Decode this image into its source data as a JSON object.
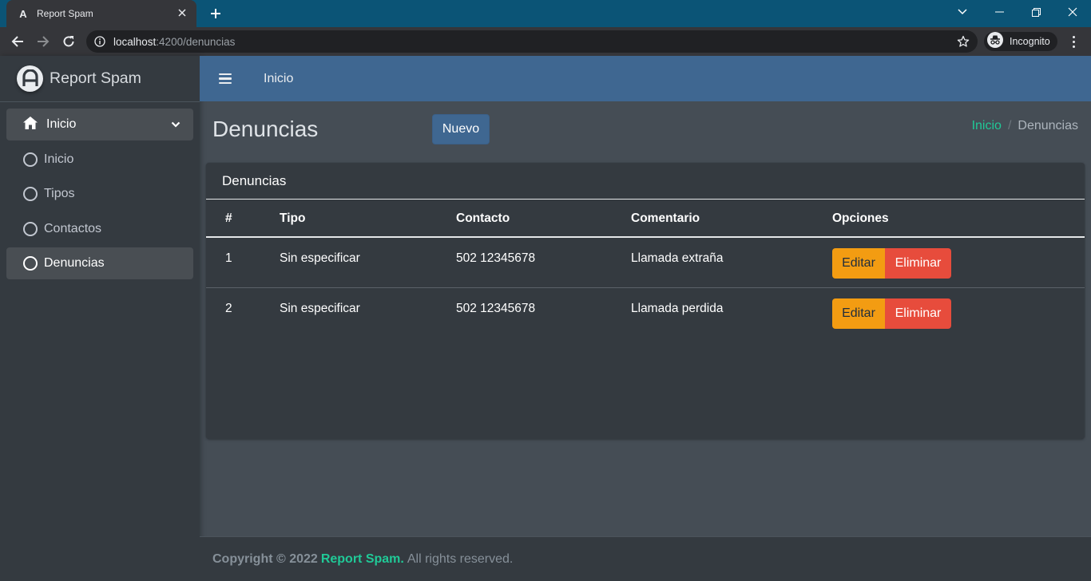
{
  "browser": {
    "tab_title": "Report Spam",
    "tab_favicon_letter": "A",
    "url_host": "localhost",
    "url_path": ":4200/denuncias",
    "incognito_label": "Incognito"
  },
  "sidebar": {
    "brand": "Report Spam",
    "parent_item": {
      "label": "Inicio",
      "icon": "home-icon"
    },
    "items": [
      {
        "label": "Inicio",
        "active": false
      },
      {
        "label": "Tipos",
        "active": false
      },
      {
        "label": "Contactos",
        "active": false
      },
      {
        "label": "Denuncias",
        "active": true
      }
    ]
  },
  "header": {
    "link": "Inicio"
  },
  "content": {
    "title": "Denuncias",
    "new_button": "Nuevo",
    "breadcrumb": {
      "home": "Inicio",
      "separator": "/",
      "current": "Denuncias"
    }
  },
  "card": {
    "title": "Denuncias",
    "columns": [
      "#",
      "Tipo",
      "Contacto",
      "Comentario",
      "Opciones"
    ],
    "rows": [
      {
        "id": "1",
        "tipo": "Sin especificar",
        "contacto": "502 12345678",
        "comentario": "Llamada extraña"
      },
      {
        "id": "2",
        "tipo": "Sin especificar",
        "contacto": "502 12345678",
        "comentario": "Llamada perdida"
      }
    ],
    "edit_label": "Editar",
    "delete_label": "Eliminar"
  },
  "footer": {
    "copyright": "Copyright © 2022",
    "brand": "Report Spam.",
    "rights": "All rights reserved."
  },
  "colors": {
    "accent": "#20c997",
    "header_bg": "#3f6791",
    "edit_button": "#f39c12",
    "delete_button": "#e74c3c"
  }
}
